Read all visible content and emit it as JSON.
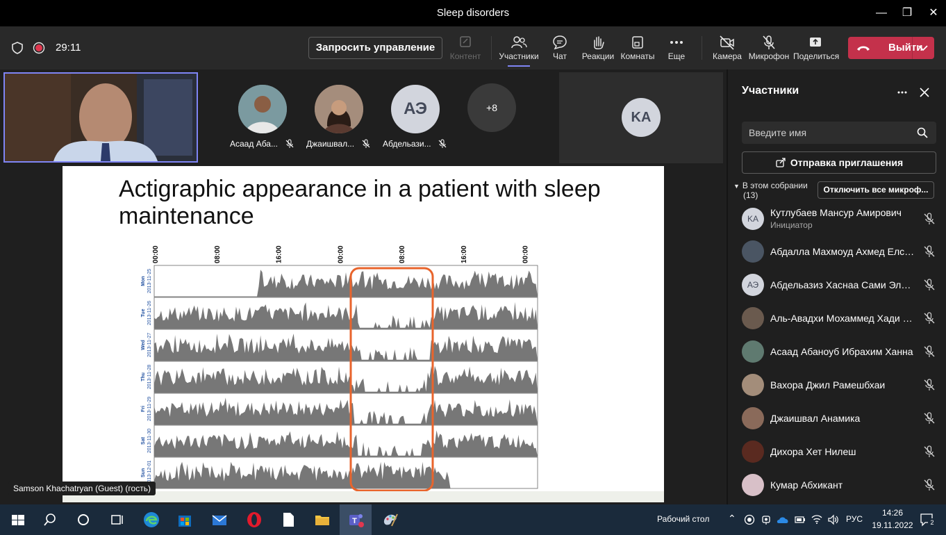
{
  "window": {
    "title": "Sleep disorders"
  },
  "toolbar": {
    "timer": "29:11",
    "request_control": "Запросить управление",
    "content": "Контент",
    "participants": "Участники",
    "chat": "Чат",
    "reactions": "Реакции",
    "rooms": "Комнаты",
    "more": "Еще",
    "camera": "Камера",
    "mic": "Микрофон",
    "share": "Поделиться",
    "leave": "Выйти"
  },
  "tiles": [
    {
      "name": "Асаад Аба...",
      "initials": ""
    },
    {
      "name": "Джаишвал...",
      "initials": ""
    },
    {
      "name": "Абдельази...",
      "initials": "АЭ"
    },
    {
      "name": "",
      "initials": "+8"
    }
  ],
  "large_tile": {
    "initials": "KA"
  },
  "presenter": {
    "name": "Samson Khachatryan (Guest) (гость)"
  },
  "slide": {
    "title": "Actigraphic appearance in a patient with sleep maintenance",
    "chart": {
      "type": "actigram",
      "time_ticks": [
        "00:00",
        "08:00",
        "16:00",
        "00:00",
        "08:00",
        "16:00",
        "00:00"
      ],
      "days": [
        {
          "day": "Mon",
          "date": "2013-11-25"
        },
        {
          "day": "Tue",
          "date": "2013-11-26"
        },
        {
          "day": "Wed",
          "date": "2013-11-27"
        },
        {
          "day": "Thu",
          "date": "2013-11-28"
        },
        {
          "day": "Fri",
          "date": "2013-11-29"
        },
        {
          "day": "Sat",
          "date": "2013-11-30"
        },
        {
          "day": "Sun",
          "date": "2013-12-01"
        }
      ]
    }
  },
  "panel": {
    "title": "Участники",
    "search_placeholder": "Введите имя",
    "invite": "Отправка приглашения",
    "section_label": "В этом собрании",
    "section_count": "(13)",
    "mute_all": "Отключить все микроф...",
    "participants": [
      {
        "name": "Кутлубаев Мансур Амирович",
        "role": "Инициатор",
        "initials": "KA"
      },
      {
        "name": "Абдалла Махмоуд Ахмед Елсай...",
        "role": "",
        "initials": ""
      },
      {
        "name": "Абдельазиз Хаснаа Сами Элхус...",
        "role": "",
        "initials": "АЭ"
      },
      {
        "name": "Аль-Авадхи Мохаммед Хади М...",
        "role": "",
        "initials": ""
      },
      {
        "name": "Асаад Абаноуб Ибрахим Ханна",
        "role": "",
        "initials": ""
      },
      {
        "name": "Вахора Джил Рамешбхаи",
        "role": "",
        "initials": ""
      },
      {
        "name": "Джаишвал Анамика",
        "role": "",
        "initials": ""
      },
      {
        "name": "Дихора Хет Нилеш",
        "role": "",
        "initials": ""
      },
      {
        "name": "Кумар Абхикант",
        "role": "",
        "initials": ""
      }
    ]
  },
  "taskbar": {
    "desktop": "Рабочий стол",
    "lang": "РУС",
    "time": "14:26",
    "date": "19.11.2022",
    "notifications": "2"
  }
}
